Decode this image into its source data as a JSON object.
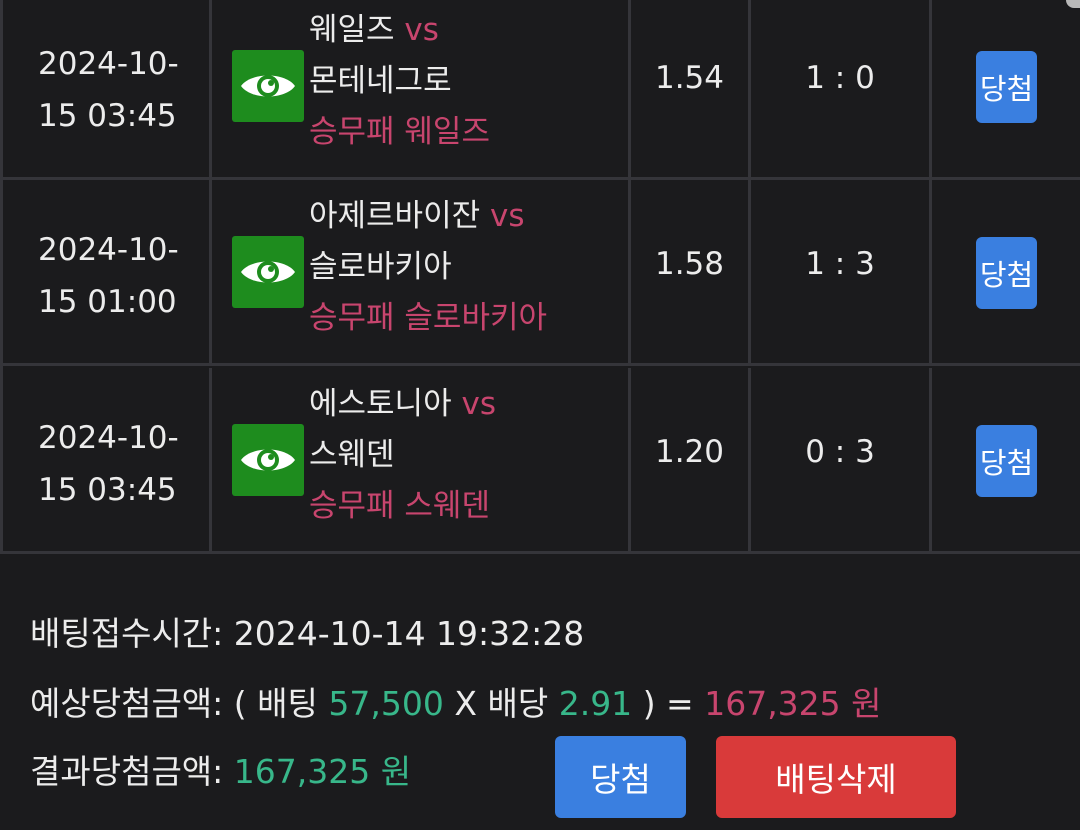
{
  "bets": [
    {
      "date_line1": "2024-10-",
      "date_line2": "15 03:45",
      "home": "웨일즈",
      "vs": "vs",
      "away": "몬테네그로",
      "pick": "승무패 웨일즈",
      "odds": "1.54",
      "score": "1 : 0",
      "result": "당첨"
    },
    {
      "date_line1": "2024-10-",
      "date_line2": "15 01:00",
      "home": "아제르바이잔",
      "vs": "vs",
      "away": "슬로바키아",
      "pick": "승무패 슬로바키아",
      "odds": "1.58",
      "score": "1 : 3",
      "result": "당첨"
    },
    {
      "date_line1": "2024-10-",
      "date_line2": "15 03:45",
      "home": "에스토니아",
      "vs": "vs",
      "away": "스웨덴",
      "pick": "승무패 스웨덴",
      "odds": "1.20",
      "score": "0 : 3",
      "result": "당첨"
    }
  ],
  "summary": {
    "bet_time_label": "배팅접수시간:",
    "bet_time_value": "2024-10-14 19:32:28",
    "expected_label": "예상당첨금액:",
    "open_paren": "(",
    "bet_word": "배팅",
    "bet_amount": "57,500",
    "times": "X",
    "odds_word": "배당",
    "total_odds": "2.91",
    "close_paren_eq": ") =",
    "expected_amount": "167,325 원",
    "result_label": "결과당첨금액:",
    "result_amount": "167,325 원"
  },
  "actions": {
    "win_label": "당첨",
    "delete_label": "배팅삭제"
  },
  "colors": {
    "background": "#1b1b1d",
    "grid": "#35353a",
    "accent_pink": "#c8456e",
    "accent_green": "#38b78a",
    "eye_button": "#1e8c1e",
    "blue_button": "#3a7fe0",
    "red_button": "#d93a3a"
  },
  "icons": {
    "view": "eye-icon"
  }
}
